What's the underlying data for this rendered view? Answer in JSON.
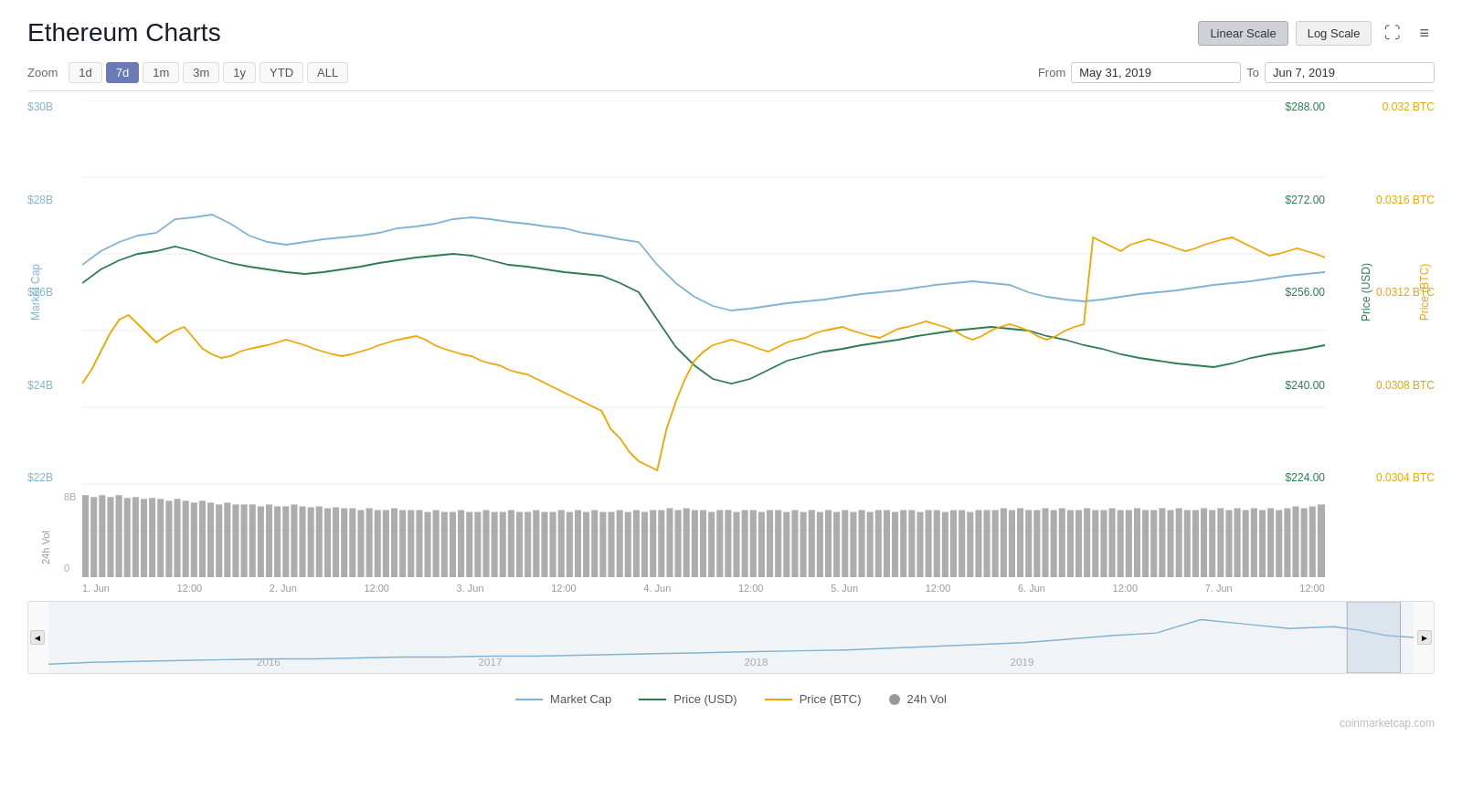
{
  "page": {
    "title": "Ethereum Charts"
  },
  "header": {
    "linear_scale_label": "Linear Scale",
    "log_scale_label": "Log Scale",
    "fullscreen_icon": "⛶",
    "menu_icon": "≡"
  },
  "zoom": {
    "label": "Zoom",
    "buttons": [
      "1d",
      "7d",
      "1m",
      "3m",
      "1y",
      "YTD",
      "ALL"
    ],
    "active": "7d"
  },
  "date_range": {
    "from_label": "From",
    "to_label": "To",
    "from_value": "May 31, 2019",
    "to_value": "Jun 7, 2019"
  },
  "y_axis_left": {
    "labels": [
      "$30B",
      "$28B",
      "$26B",
      "$24B",
      "$22B"
    ]
  },
  "y_axis_right_usd": {
    "title": "Price (USD)",
    "labels": [
      "$288.00",
      "$272.00",
      "$256.00",
      "$240.00",
      "$224.00"
    ]
  },
  "y_axis_right_btc": {
    "title": "Price (BTC)",
    "labels": [
      "0.032 BTC",
      "0.0316 BTC",
      "0.0312 BTC",
      "0.0308 BTC",
      "0.0304 BTC"
    ]
  },
  "volume": {
    "axis_label": "24h Vol",
    "y_labels": [
      "8B",
      "0"
    ]
  },
  "x_axis": {
    "labels": [
      "1. Jun",
      "12:00",
      "2. Jun",
      "12:00",
      "3. Jun",
      "12:00",
      "4. Jun",
      "12:00",
      "5. Jun",
      "12:00",
      "6. Jun",
      "12:00",
      "7. Jun",
      "12:00"
    ]
  },
  "mini_chart": {
    "year_labels": [
      {
        "year": "2016",
        "pct": 16
      },
      {
        "year": "2017",
        "pct": 33
      },
      {
        "year": "2018",
        "pct": 52
      },
      {
        "year": "2019",
        "pct": 71
      }
    ]
  },
  "legend": {
    "items": [
      {
        "label": "Market Cap",
        "color": "#82b4d2",
        "type": "line"
      },
      {
        "label": "Price (USD)",
        "color": "#2e7d52",
        "type": "line"
      },
      {
        "label": "Price (BTC)",
        "color": "#f0a500",
        "type": "line"
      },
      {
        "label": "24h Vol",
        "color": "#999",
        "type": "dot"
      }
    ]
  },
  "watermark": "coinmarketcap.com"
}
